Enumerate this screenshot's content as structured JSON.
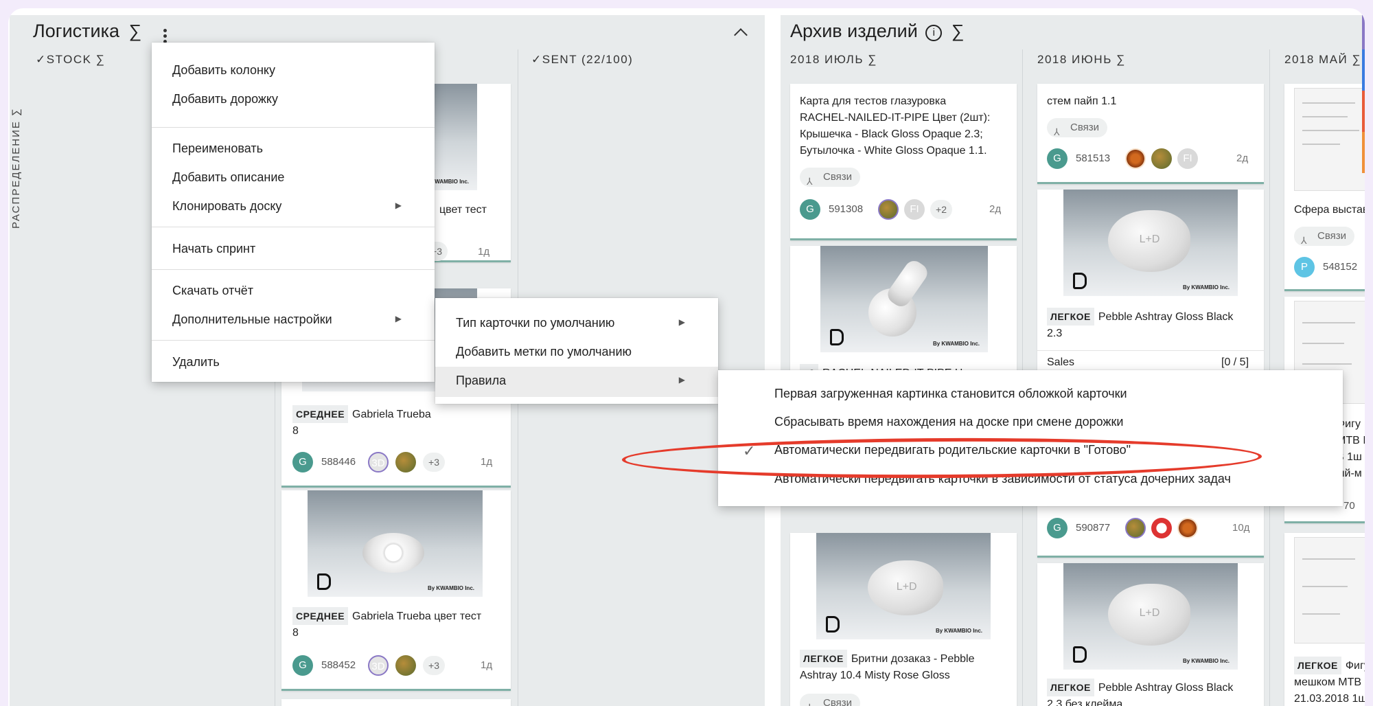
{
  "board_left": {
    "title": "Логистика",
    "sigma": "∑",
    "menu_icon": "more-vert-icon",
    "collapse_icon": "chevron-up-icon",
    "columns": [
      {
        "label": "STOCK ∑"
      },
      {
        "label": "SENT (22/100)"
      }
    ],
    "lane_label": "РАСПРЕДЕЛЕНИЕ ∑",
    "cards": [
      {
        "title_tail": "цвет тест",
        "count": "+3",
        "age": "1д"
      },
      {
        "tag": "СРЕДНЕЕ",
        "title": "Gabriela Trueba",
        "title2": "8",
        "id": "588446",
        "av": "3D",
        "count": "+3",
        "age": "1д"
      },
      {
        "tag": "СРЕДНЕЕ",
        "title": "Gabriela Trueba цвет тест",
        "title2": "8",
        "id": "588452",
        "av": "3D",
        "count": "+3",
        "age": "1д",
        "brand": "By KWAMBIO Inc."
      }
    ]
  },
  "board_right": {
    "title": "Архив изделий",
    "sigma": "∑",
    "info_icon": "info-icon",
    "columns": [
      {
        "label": "2018 ИЮЛЬ ∑"
      },
      {
        "label": "2018 ИЮНЬ ∑"
      },
      {
        "label": "2018 МАЙ ∑"
      }
    ],
    "cards": {
      "c1": {
        "lines": [
          "Карта для тестов глазуровка",
          "RACHEL-NAILED-IT-PIPE Цвет (2шт):",
          "Крышечка - Black Gloss Opaque 2.3;",
          "Бутылочка - White Gloss Opaque 1.1."
        ],
        "chip": "Связи",
        "avatar": "G",
        "id": "591308",
        "fi": "FI",
        "count": "+2",
        "age": "2д"
      },
      "c2": {
        "count_tag": "+2",
        "title": "RACHEL-NAILED-IT-PIPE Цвет"
      },
      "c3": {
        "tag": "ЛЕГКОЕ",
        "title": "Бритни дозаказ - Pebble",
        "title2": "Ashtray 10.4 Misty Rose Gloss",
        "chip": "Связи"
      },
      "c4": {
        "title": "стем пайп 1.1",
        "chip": "Связи",
        "avatar": "G",
        "id": "581513",
        "fi": "FI",
        "age": "2д"
      },
      "c5": {
        "tag": "ЛЕГКОЕ",
        "title": "Pebble Ashtray Gloss Black",
        "title2": "2.3",
        "sales_label": "Sales",
        "sales_val": "[0 / 5]"
      },
      "c6": {
        "avatar": "G",
        "id": "590877",
        "age": "10д"
      },
      "c7": {
        "tag": "ЛЕГКОЕ",
        "title": "Pebble Ashtray Gloss Black",
        "title2": "2.3 без клейма"
      },
      "c8": {
        "title": "Сфера выстав",
        "chip": "Связи",
        "avatar": "P",
        "id": "548152"
      },
      "c9": {
        "lines": [
          "Фигу",
          "МТВ I",
          "В 1ш",
          "ый-м"
        ],
        "num": "70"
      },
      "c10": {
        "tag": "ЛЕГКОЕ",
        "title": "Фигу",
        "title2": "мешком МТВ I",
        "title3": "21.03.2018 1ш"
      }
    },
    "brand": "By KWAMBIO Inc."
  },
  "menu_main": {
    "items": [
      {
        "label": "Добавить колонку"
      },
      {
        "label": "Добавить дорожку"
      },
      {
        "label": "Переименовать"
      },
      {
        "label": "Добавить описание"
      },
      {
        "label": "Клонировать доску",
        "submenu": true
      },
      {
        "label": "Начать спринт"
      },
      {
        "label": "Скачать отчёт"
      },
      {
        "label": "Дополнительные настройки",
        "submenu": true
      },
      {
        "label": "Удалить"
      }
    ]
  },
  "menu_sub": {
    "items": [
      {
        "label": "Тип карточки по умолчанию",
        "submenu": true
      },
      {
        "label": "Добавить метки по умолчанию"
      },
      {
        "label": "Правила",
        "submenu": true,
        "highlighted": true
      }
    ]
  },
  "menu_rules": {
    "items": [
      {
        "label": "Первая загруженная картинка становится обложкой карточки",
        "checked": false
      },
      {
        "label": "Сбрасывать время нахождения на доске при смене дорожки",
        "checked": false
      },
      {
        "label": "Автоматически передвигать родительские карточки в \"Готово\"",
        "checked": true
      },
      {
        "label": "Автоматически передвигать карточки в зависимости от статуса дочерних задач",
        "checked": false
      }
    ],
    "highlight_color": "#e53b2b"
  },
  "accent_colors": {
    "teal": "#4a9a8e",
    "purple": "#8a78c5",
    "orange": "#f0913a",
    "blue": "#3a7be0"
  }
}
